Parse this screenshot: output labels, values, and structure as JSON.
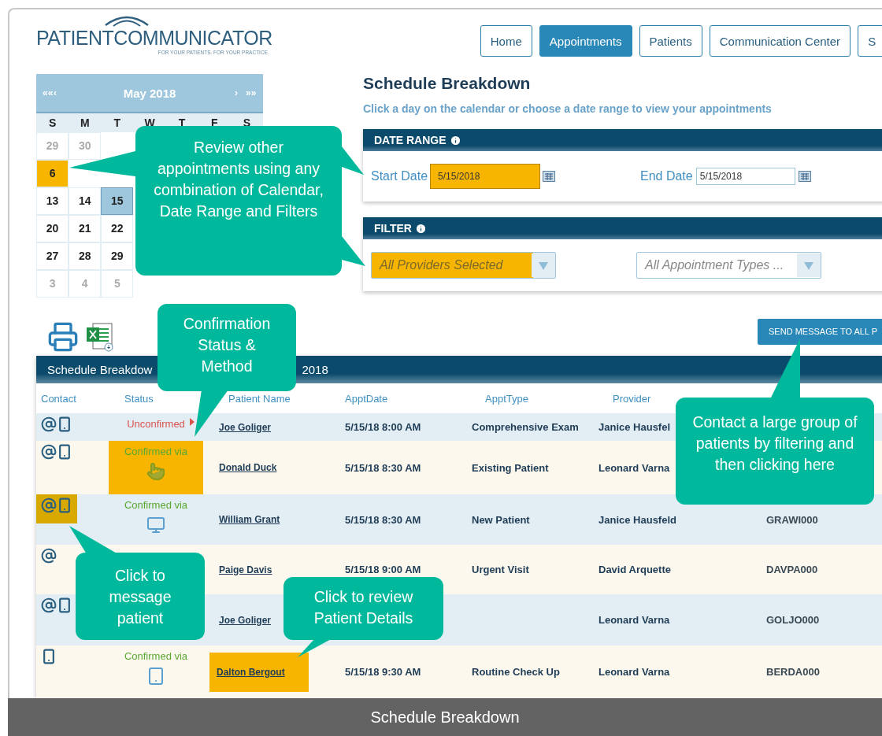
{
  "logo": {
    "name": "PATIENTCOMMUNICATOR",
    "tagline": "FOR YOUR PATIENTS.  FOR YOUR PRACTICE."
  },
  "nav": [
    {
      "label": "Home",
      "selected": false
    },
    {
      "label": "Appointments",
      "selected": true
    },
    {
      "label": "Patients",
      "selected": false
    },
    {
      "label": "Communication Center",
      "selected": false
    },
    {
      "label": "S",
      "selected": false
    }
  ],
  "calendar": {
    "month": "May 2018",
    "prev_year": "««",
    "prev": "‹",
    "next": "›",
    "next_year": "»»",
    "weekdays": [
      "S",
      "M",
      "T",
      "W",
      "T",
      "F",
      "S"
    ],
    "weeks": [
      [
        {
          "day": "29",
          "muted": true,
          "selected": false,
          "highlighted": false
        },
        {
          "day": "30",
          "muted": true,
          "selected": false,
          "highlighted": false
        }
      ],
      [
        {
          "day": "6",
          "muted": false,
          "selected": false,
          "highlighted": true
        }
      ],
      [
        {
          "day": "13",
          "muted": false,
          "selected": false,
          "highlighted": false
        },
        {
          "day": "14",
          "muted": false,
          "selected": false,
          "highlighted": false
        },
        {
          "day": "15",
          "muted": false,
          "selected": true,
          "highlighted": false
        }
      ],
      [
        {
          "day": "20",
          "muted": false,
          "selected": false,
          "highlighted": false
        },
        {
          "day": "21",
          "muted": false,
          "selected": false,
          "highlighted": false
        },
        {
          "day": "22",
          "muted": false,
          "selected": false,
          "highlighted": false
        }
      ],
      [
        {
          "day": "27",
          "muted": false,
          "selected": false,
          "highlighted": false
        },
        {
          "day": "28",
          "muted": false,
          "selected": false,
          "highlighted": false
        },
        {
          "day": "29",
          "muted": false,
          "selected": false,
          "highlighted": false
        }
      ],
      [
        {
          "day": "3",
          "muted": true,
          "selected": false,
          "highlighted": false
        },
        {
          "day": "4",
          "muted": true,
          "selected": false,
          "highlighted": false
        },
        {
          "day": "5",
          "muted": true,
          "selected": false,
          "highlighted": false
        }
      ]
    ]
  },
  "heading": "Schedule Breakdown",
  "subtitle": "Click a day on the calendar or choose a date range to view your appointments",
  "date_range": {
    "title": "DATE RANGE",
    "fields": [
      {
        "label": "Start Date",
        "value": "5/15/2018",
        "highlighted": true
      },
      {
        "label": "End Date",
        "value": "5/15/2018",
        "highlighted": false
      }
    ]
  },
  "filter": {
    "title": "FILTER",
    "selects": [
      {
        "placeholder": "All Providers Selected",
        "highlighted": true
      },
      {
        "placeholder": "All Appointment Types ...",
        "highlighted": false
      }
    ]
  },
  "send_button": "SEND MESSAGE TO ALL P",
  "table": {
    "title_start": "Schedule Breakdow",
    "title_end": "2018",
    "columns": [
      "Contact",
      "Status",
      "Patient Name",
      "ApptDate",
      "ApptType",
      "Provider"
    ],
    "rows": [
      {
        "contact": [
          {
            "kind": "email"
          },
          {
            "kind": "phone"
          }
        ],
        "contact_highlighted": false,
        "status": {
          "kind": "unconfirmed",
          "text": "Unconfirmed"
        },
        "status_highlighted": false,
        "name": "Joe Goliger",
        "name_highlighted": false,
        "date": "5/15/18 8:00 AM",
        "type": "Comprehensive Exam",
        "provider": "Janice Hausfel"
      },
      {
        "contact": [
          {
            "kind": "email"
          },
          {
            "kind": "phone"
          }
        ],
        "contact_highlighted": false,
        "status": {
          "kind": "confirmed",
          "text": "Confirmed via",
          "method": {
            "kind": "touch"
          }
        },
        "status_highlighted": true,
        "name": "Donald Duck",
        "name_highlighted": false,
        "date": "5/15/18 8:30 AM",
        "type": "Existing Patient",
        "provider": "Leonard Varna"
      },
      {
        "contact": [
          {
            "kind": "email"
          },
          {
            "kind": "phone"
          }
        ],
        "contact_highlighted": true,
        "status": {
          "kind": "confirmed",
          "text": "Confirmed via",
          "method": {
            "kind": "computer"
          }
        },
        "status_highlighted": false,
        "name": "William Grant",
        "name_highlighted": false,
        "date": "5/15/18 8:30 AM",
        "type": "New Patient",
        "provider": "Janice Hausfeld",
        "id": "GRAWI000"
      },
      {
        "contact": [
          {
            "kind": "email"
          }
        ],
        "contact_highlighted": false,
        "status_highlighted": false,
        "name": "Paige Davis",
        "name_highlighted": false,
        "date": "5/15/18 9:00 AM",
        "type": "Urgent Visit",
        "provider": "David Arquette",
        "id": "DAVPA000"
      },
      {
        "contact": [
          {
            "kind": "email"
          },
          {
            "kind": "phone"
          }
        ],
        "contact_highlighted": false,
        "status_highlighted": false,
        "name": "Joe Goliger",
        "name_highlighted": false,
        "provider": "Leonard Varna",
        "id": "GOLJO000"
      },
      {
        "contact": [
          {
            "kind": "phone"
          }
        ],
        "contact_highlighted": false,
        "status": {
          "kind": "confirmed",
          "text": "Confirmed via",
          "method": {
            "kind": "tablet"
          }
        },
        "status_highlighted": false,
        "name": "Dalton Bergout",
        "name_highlighted": true,
        "date": "5/15/18 9:30 AM",
        "type": "Routine Check Up",
        "provider": "Leonard Varna",
        "id": "BERDA000"
      }
    ]
  },
  "callouts": [
    {
      "text": "Review other appointments using any combination of Calendar, Date Range and Filters"
    },
    {
      "text": "Confirmation Status & Method"
    },
    {
      "text": "Contact a large group of patients by filtering and then clicking here"
    },
    {
      "text": "Click to message patient"
    },
    {
      "text": "Click to review Patient Details"
    }
  ],
  "caption": "Schedule Breakdown"
}
